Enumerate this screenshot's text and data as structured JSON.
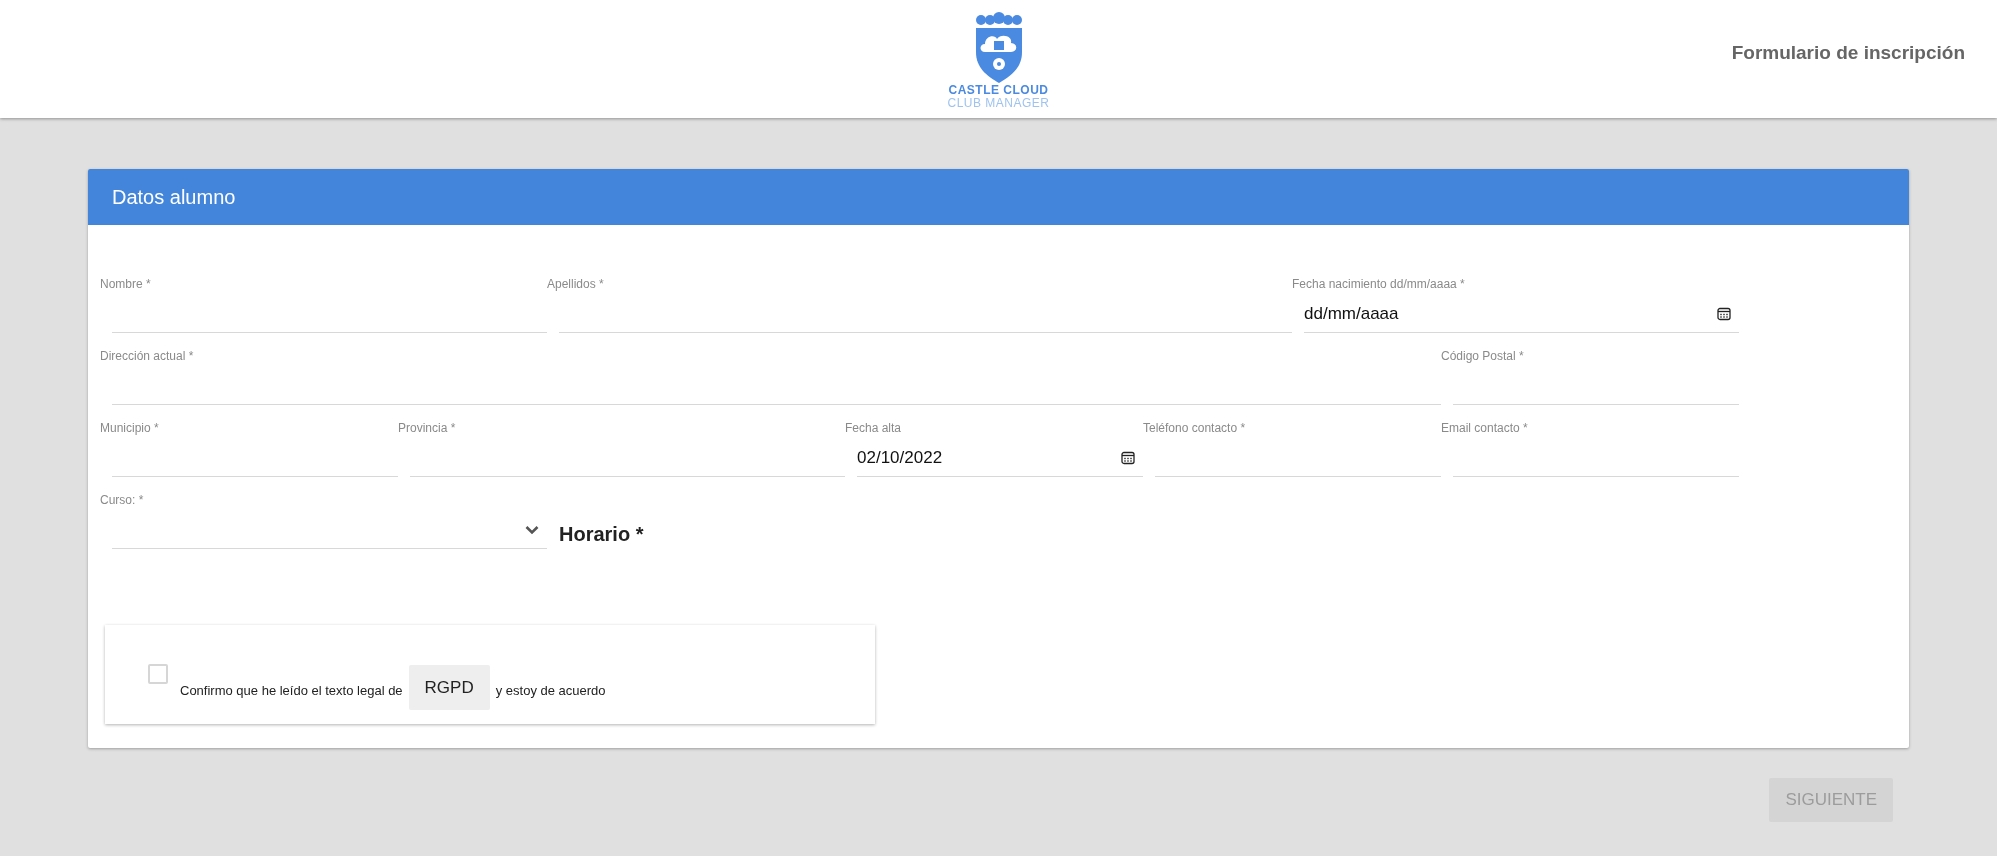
{
  "header": {
    "logo": {
      "line_1": "CASTLE CLOUD",
      "line_2": "CLUB MANAGER"
    },
    "title": "Formulario de inscripción"
  },
  "card": {
    "title": "Datos alumno",
    "rows": [
      {
        "fields": [
          {
            "kind": "text",
            "label": "Nombre *"
          },
          {
            "kind": "text",
            "label": "Apellidos *"
          },
          {
            "kind": "date",
            "label": "Fecha nacimiento dd/mm/aaaa *",
            "placeholder": "dd/mm/aaaa"
          }
        ]
      },
      {
        "fields": [
          {
            "kind": "text",
            "label": "Dirección actual *"
          },
          {
            "kind": "text",
            "label": "Código Postal *"
          }
        ]
      },
      {
        "fields": [
          {
            "kind": "text",
            "label": "Municipio *"
          },
          {
            "kind": "text",
            "label": "Provincia *"
          },
          {
            "kind": "date",
            "label": "Fecha alta",
            "value": "02/10/2022"
          },
          {
            "kind": "text",
            "label": "Teléfono contacto *"
          },
          {
            "kind": "text",
            "label": "Email contacto *"
          }
        ]
      },
      {
        "fields": [
          {
            "kind": "select",
            "label": "Curso: *"
          },
          {
            "kind": "heading",
            "label": "Horario *"
          }
        ]
      }
    ],
    "consent": {
      "checked": false,
      "text_before": "Confirmo que he leído el texto legal de",
      "link": "RGPD",
      "text_after": "y estoy de acuerdo"
    }
  },
  "next_button": {
    "label": "SIGUIENTE",
    "disabled": true
  }
}
